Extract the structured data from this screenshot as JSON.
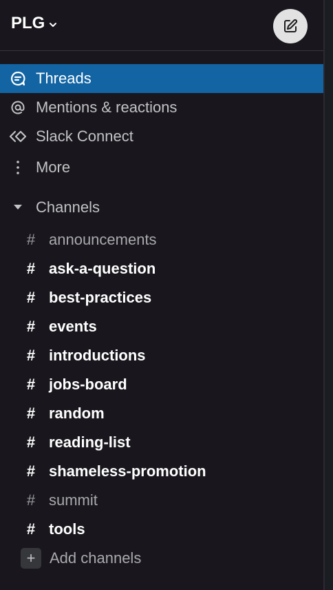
{
  "workspace": {
    "name": "PLG"
  },
  "nav": {
    "items": [
      {
        "label": "Threads",
        "icon": "threads-icon",
        "active": true
      },
      {
        "label": "Mentions & reactions",
        "icon": "at-icon",
        "active": false
      },
      {
        "label": "Slack Connect",
        "icon": "slack-connect-icon",
        "active": false
      },
      {
        "label": "More",
        "icon": "more-vertical-icon",
        "active": false
      }
    ]
  },
  "channels": {
    "header": "Channels",
    "items": [
      {
        "name": "announcements",
        "unread": false
      },
      {
        "name": "ask-a-question",
        "unread": true
      },
      {
        "name": "best-practices",
        "unread": true
      },
      {
        "name": "events",
        "unread": true
      },
      {
        "name": "introductions",
        "unread": true
      },
      {
        "name": "jobs-board",
        "unread": true
      },
      {
        "name": "random",
        "unread": true
      },
      {
        "name": "reading-list",
        "unread": true
      },
      {
        "name": "shameless-promotion",
        "unread": true
      },
      {
        "name": "summit",
        "unread": false
      },
      {
        "name": "tools",
        "unread": true
      }
    ],
    "hash_symbol": "#",
    "add_label": "Add channels",
    "add_symbol": "+"
  },
  "colors": {
    "sidebar_bg": "#19171d",
    "active_bg": "#1264a3",
    "unread_text": "#ffffff",
    "read_text": "#a9aaad"
  }
}
